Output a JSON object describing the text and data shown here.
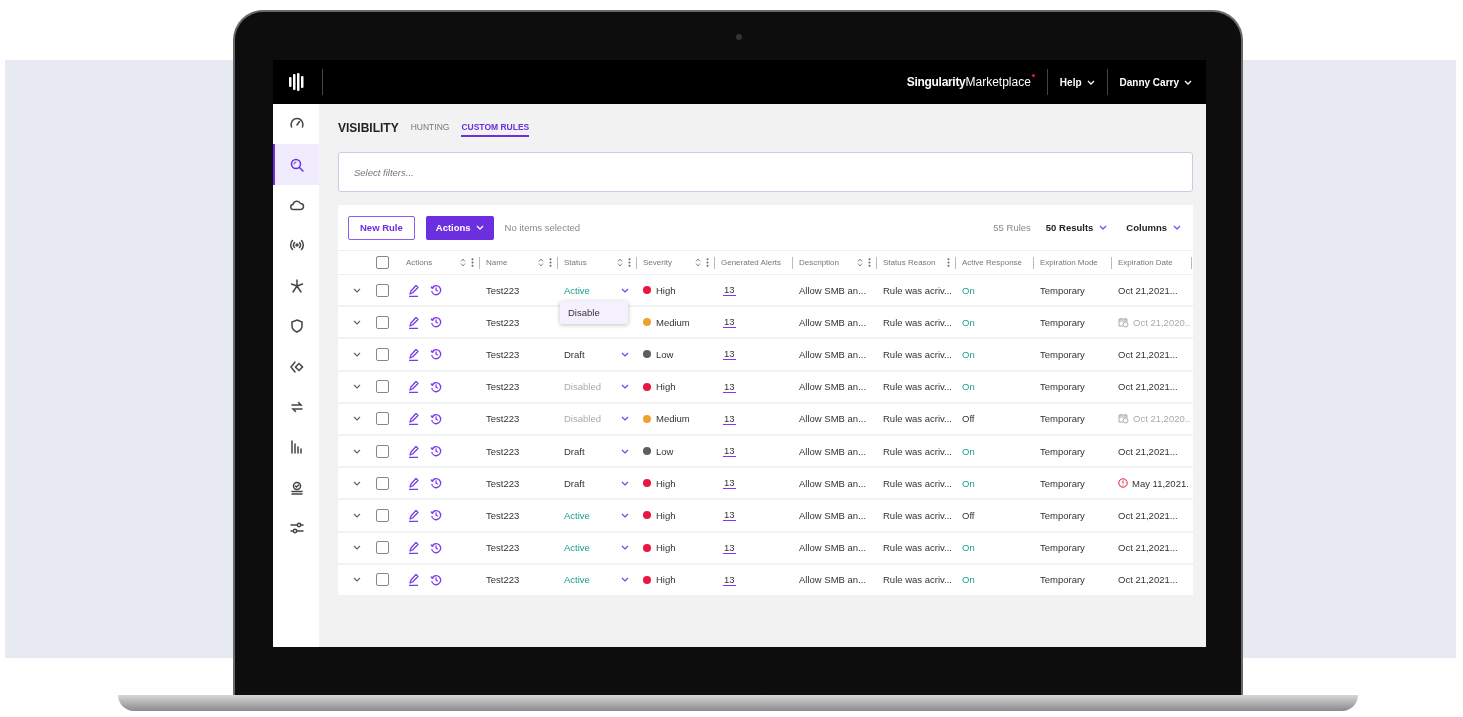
{
  "topbar": {
    "brand_name": "Singularity",
    "brand_suffix": "Marketplace",
    "menus": [
      {
        "label": "Help"
      },
      {
        "label": "Danny Carry"
      }
    ]
  },
  "sidebar": {
    "items": [
      {
        "selected": false
      },
      {
        "selected": true
      },
      {
        "selected": false
      },
      {
        "selected": false
      },
      {
        "selected": false
      },
      {
        "selected": false
      },
      {
        "selected": false
      },
      {
        "selected": false
      },
      {
        "selected": false
      },
      {
        "selected": false
      },
      {
        "selected": false
      }
    ]
  },
  "page": {
    "title": "VISIBILITY",
    "tabs": [
      {
        "label": "HUNTING",
        "selected": false
      },
      {
        "label": "CUSTOM RULES",
        "selected": true
      }
    ]
  },
  "filter": {
    "placeholder": "Select filters..."
  },
  "toolbar": {
    "new_button": "New Rule",
    "actions_button": "Actions",
    "selection": "No items selected",
    "count": "55 Rules",
    "results": "50 Results",
    "columns": "Columns"
  },
  "table": {
    "select_all_checked": false,
    "columns": [
      {
        "label": "Actions",
        "sortable": true,
        "menu": true
      },
      {
        "label": "Name",
        "sortable": true,
        "menu": true
      },
      {
        "label": "Status",
        "sortable": true,
        "menu": true
      },
      {
        "label": "Severity",
        "sortable": true,
        "menu": true
      },
      {
        "label": "Generated Alerts",
        "sortable": false,
        "menu": false
      },
      {
        "label": "Description",
        "sortable": true,
        "menu": true
      },
      {
        "label": "Status Reason",
        "sortable": false,
        "menu": true
      },
      {
        "label": "Active Response",
        "sortable": false,
        "menu": false
      },
      {
        "label": "Expiration Mode",
        "sortable": false,
        "menu": false
      },
      {
        "label": "Expiration Date",
        "sortable": false,
        "menu": false
      }
    ],
    "rows": [
      {
        "checked": false,
        "name": "Test223",
        "status": {
          "label": "Active",
          "kind": "active"
        },
        "severity": {
          "label": "High",
          "color": "#e8173f"
        },
        "alerts": "13",
        "description": "Allow SMB an...",
        "reason": "Rule was acriv...",
        "response": {
          "label": "On",
          "on": true
        },
        "mode": "Temporary",
        "date": {
          "label": "Oct 21,2021...",
          "kind": "normal"
        }
      },
      {
        "checked": false,
        "name": "Test223",
        "severity": {
          "label": "Medium",
          "color": "#f0a030"
        },
        "alerts": "13",
        "description": "Allow SMB an...",
        "reason": "Rule was acriv...",
        "response": {
          "label": "On",
          "on": true
        },
        "mode": "Temporary",
        "date": {
          "label": "Oct 21,2020..",
          "kind": "scheduled"
        }
      },
      {
        "checked": false,
        "name": "Test223",
        "status": {
          "label": "Draft",
          "kind": "draft"
        },
        "severity": {
          "label": "Low",
          "color": "#5e5e5e"
        },
        "alerts": "13",
        "description": "Allow SMB an...",
        "reason": "Rule was acriv...",
        "response": {
          "label": "On",
          "on": true
        },
        "mode": "Temporary",
        "date": {
          "label": "Oct 21,2021...",
          "kind": "normal"
        }
      },
      {
        "checked": false,
        "name": "Test223",
        "status": {
          "label": "Disabled",
          "kind": "disabled"
        },
        "severity": {
          "label": "High",
          "color": "#e8173f"
        },
        "alerts": "13",
        "description": "Allow SMB an...",
        "reason": "Rule was acriv...",
        "response": {
          "label": "On",
          "on": true
        },
        "mode": "Temporary",
        "date": {
          "label": "Oct 21,2021...",
          "kind": "normal"
        }
      },
      {
        "checked": false,
        "name": "Test223",
        "status": {
          "label": "Disabled",
          "kind": "disabled"
        },
        "severity": {
          "label": "Medium",
          "color": "#f0a030"
        },
        "alerts": "13",
        "description": "Allow SMB an...",
        "reason": "Rule was acriv...",
        "response": {
          "label": "Off",
          "on": false
        },
        "mode": "Temporary",
        "date": {
          "label": "Oct 21,2020..",
          "kind": "scheduled"
        }
      },
      {
        "checked": false,
        "name": "Test223",
        "status": {
          "label": "Draft",
          "kind": "draft"
        },
        "severity": {
          "label": "Low",
          "color": "#5e5e5e"
        },
        "alerts": "13",
        "description": "Allow SMB an...",
        "reason": "Rule was acriv...",
        "response": {
          "label": "On",
          "on": true
        },
        "mode": "Temporary",
        "date": {
          "label": "Oct 21,2021...",
          "kind": "normal"
        }
      },
      {
        "checked": false,
        "name": "Test223",
        "status": {
          "label": "Draft",
          "kind": "draft"
        },
        "severity": {
          "label": "High",
          "color": "#e8173f"
        },
        "alerts": "13",
        "description": "Allow SMB an...",
        "reason": "Rule was acriv...",
        "response": {
          "label": "On",
          "on": true
        },
        "mode": "Temporary",
        "date": {
          "label": "May 11,2021.",
          "kind": "warning"
        }
      },
      {
        "checked": false,
        "name": "Test223",
        "status": {
          "label": "Active",
          "kind": "active"
        },
        "severity": {
          "label": "High",
          "color": "#e8173f"
        },
        "alerts": "13",
        "description": "Allow SMB an...",
        "reason": "Rule was acriv...",
        "response": {
          "label": "Off",
          "on": false
        },
        "mode": "Temporary",
        "date": {
          "label": "Oct 21,2021...",
          "kind": "normal"
        }
      },
      {
        "checked": false,
        "name": "Test223",
        "status": {
          "label": "Active",
          "kind": "active"
        },
        "severity": {
          "label": "High",
          "color": "#e8173f"
        },
        "alerts": "13",
        "description": "Allow SMB an...",
        "reason": "Rule was acriv...",
        "response": {
          "label": "On",
          "on": true
        },
        "mode": "Temporary",
        "date": {
          "label": "Oct 21,2021...",
          "kind": "normal"
        }
      },
      {
        "checked": false,
        "name": "Test223",
        "status": {
          "label": "Active",
          "kind": "active"
        },
        "severity": {
          "label": "High",
          "color": "#e8173f"
        },
        "alerts": "13",
        "description": "Allow SMB an...",
        "reason": "Rule was acriv...",
        "response": {
          "label": "On",
          "on": true
        },
        "mode": "Temporary",
        "date": {
          "label": "Oct 21,2021...",
          "kind": "normal"
        }
      }
    ]
  },
  "status_menu": {
    "items": [
      {
        "label": "Disable"
      }
    ]
  }
}
